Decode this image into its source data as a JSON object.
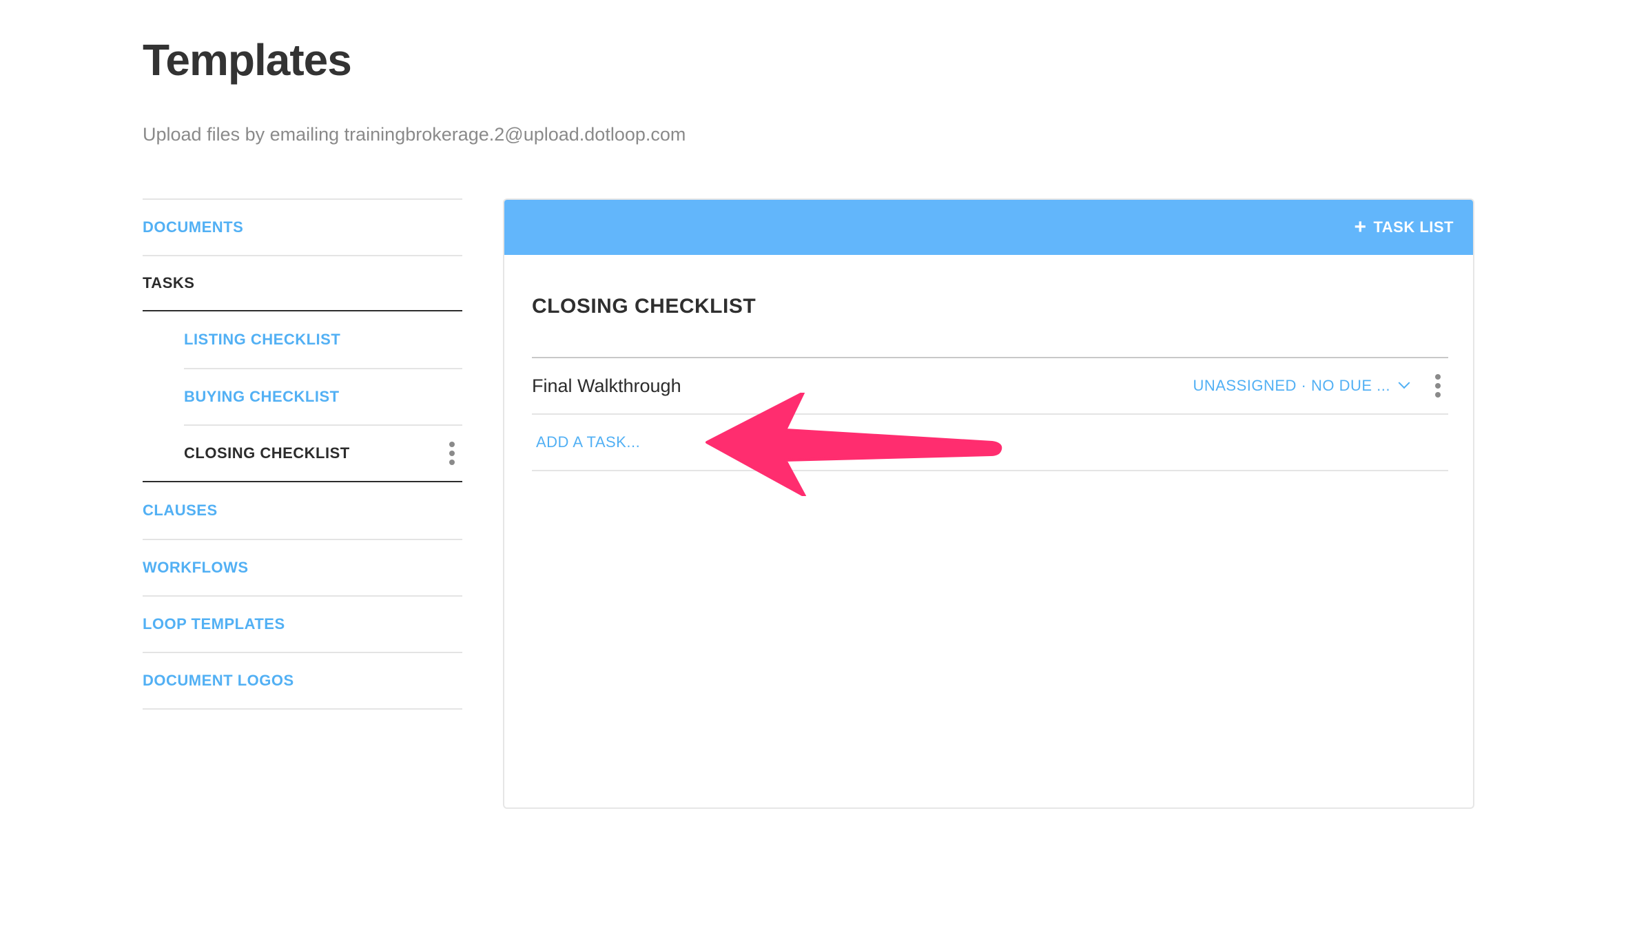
{
  "page": {
    "title": "Templates",
    "subtitle": "Upload files by emailing trainingbrokerage.2@upload.dotloop.com"
  },
  "sidebar": {
    "items": [
      {
        "label": "DOCUMENTS"
      },
      {
        "label": "TASKS"
      },
      {
        "label": "LISTING CHECKLIST"
      },
      {
        "label": "BUYING CHECKLIST"
      },
      {
        "label": "CLOSING CHECKLIST"
      },
      {
        "label": "CLAUSES"
      },
      {
        "label": "WORKFLOWS"
      },
      {
        "label": "LOOP TEMPLATES"
      },
      {
        "label": "DOCUMENT LOGOS"
      }
    ]
  },
  "panel": {
    "add_task_list_label": "TASK LIST",
    "list_title": "CLOSING CHECKLIST",
    "tasks": [
      {
        "name": "Final Walkthrough",
        "meta": "UNASSIGNED · NO DUE ..."
      }
    ],
    "add_task_placeholder": "ADD A TASK..."
  },
  "colors": {
    "accent": "#52b0f4",
    "header": "#62b6fb",
    "annotation": "#ff2d6f"
  }
}
